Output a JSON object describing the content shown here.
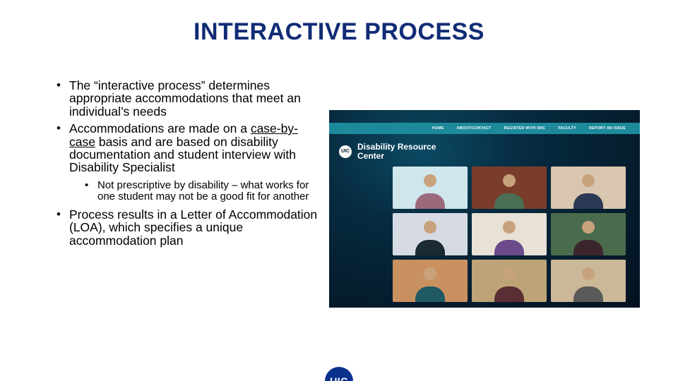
{
  "title": "INTERACTIVE PROCESS",
  "bullets": {
    "b1": "The “interactive process” determines appropriate accommodations that meet an individual’s needs",
    "b2_pre": "Accommodations are made on a ",
    "b2_u": "case-by-case",
    "b2_post": " basis and are based on disability documentation and student interview with Disability Specialist",
    "b2_sub": "Not prescriptive by disability – what works for one student may not be a good fit for another",
    "b3": "Process results in a Letter of Accommodation (LOA), which specifies a unique accommodation plan"
  },
  "screenshot": {
    "nav": {
      "n1": "HOME",
      "n2": "ABOUT/CONTACT",
      "n3": "REGISTER WITH DRC",
      "n4": "FACULTY",
      "n5": "REPORT AN ISSUE"
    },
    "brand_badge": "UIC",
    "brand_line1": "Disability",
    "brand_line2": "Resource",
    "brand_line3": "Center"
  },
  "logo": {
    "text": "UIC"
  }
}
